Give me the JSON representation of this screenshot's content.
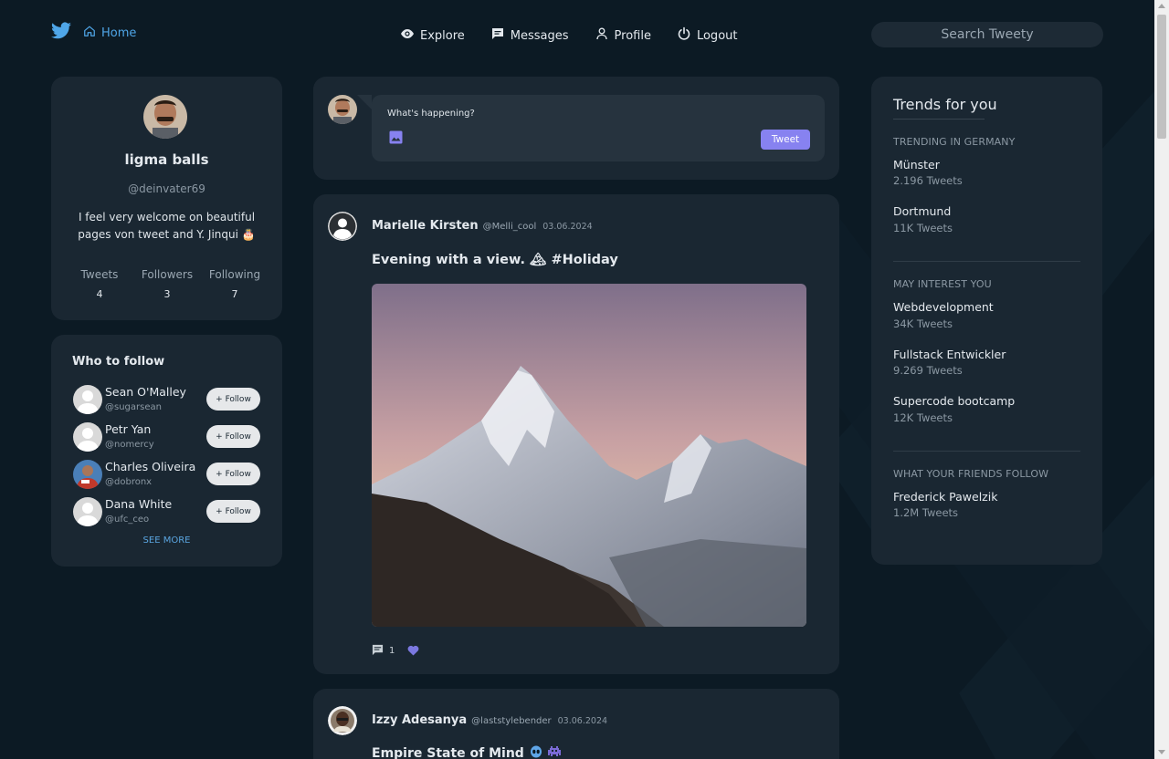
{
  "nav": {
    "home_label": "Home",
    "links": [
      {
        "label": "Explore",
        "icon": "eye-icon"
      },
      {
        "label": "Messages",
        "icon": "message-icon"
      },
      {
        "label": "Profile",
        "icon": "user-icon"
      },
      {
        "label": "Logout",
        "icon": "power-icon"
      }
    ],
    "search_placeholder": "Search Tweety"
  },
  "profile": {
    "name": "ligma balls",
    "handle": "@deinvater69",
    "bio": "I feel very welcome on beautiful pages von tweet and Y. Jinqui 🎂",
    "stats": [
      {
        "label": "Tweets",
        "value": "4"
      },
      {
        "label": "Followers",
        "value": "3"
      },
      {
        "label": "Following",
        "value": "7"
      }
    ]
  },
  "who_to_follow": {
    "title": "Who to follow",
    "follow_label": "+ Follow",
    "see_more": "SEE MORE",
    "users": [
      {
        "name": "Sean O'Malley",
        "handle": "@sugarsean"
      },
      {
        "name": "Petr Yan",
        "handle": "@nomercy"
      },
      {
        "name": "Charles Oliveira",
        "handle": "@dobronx"
      },
      {
        "name": "Dana White",
        "handle": "@ufc_ceo"
      }
    ]
  },
  "compose": {
    "placeholder": "What's happening?",
    "tweet_button": "Tweet"
  },
  "tweets": [
    {
      "name": "Marielle Kirsten",
      "handle": "@Melli_cool",
      "date": "03.06.2024",
      "text": "Evening with a view. 🏔 #Holiday",
      "comment_count": "1"
    },
    {
      "name": "Izzy Adesanya",
      "handle": "@laststylebender",
      "date": "03.06.2024",
      "text": "Empire State of Mind"
    }
  ],
  "trends": {
    "title": "Trends for you",
    "sections": [
      {
        "label": "TRENDING IN GERMANY",
        "items": [
          {
            "name": "Münster",
            "count": "2.196 Tweets"
          },
          {
            "name": "Dortmund",
            "count": "11K Tweets"
          }
        ]
      },
      {
        "label": "MAY INTEREST YOU",
        "items": [
          {
            "name": "Webdevelopment",
            "count": "34K Tweets"
          },
          {
            "name": "Fullstack Entwickler",
            "count": "9.269 Tweets"
          },
          {
            "name": "Supercode bootcamp",
            "count": "12K Tweets"
          }
        ]
      },
      {
        "label": "WHAT YOUR FRIENDS FOLLOW",
        "items": [
          {
            "name": "Frederick Pawelzik",
            "count": "1.2M Tweets"
          }
        ]
      }
    ]
  },
  "colors": {
    "background": "#0c1a24",
    "card": "#1a2732",
    "accent": "#8782f0",
    "link": "#4fa6e8"
  }
}
